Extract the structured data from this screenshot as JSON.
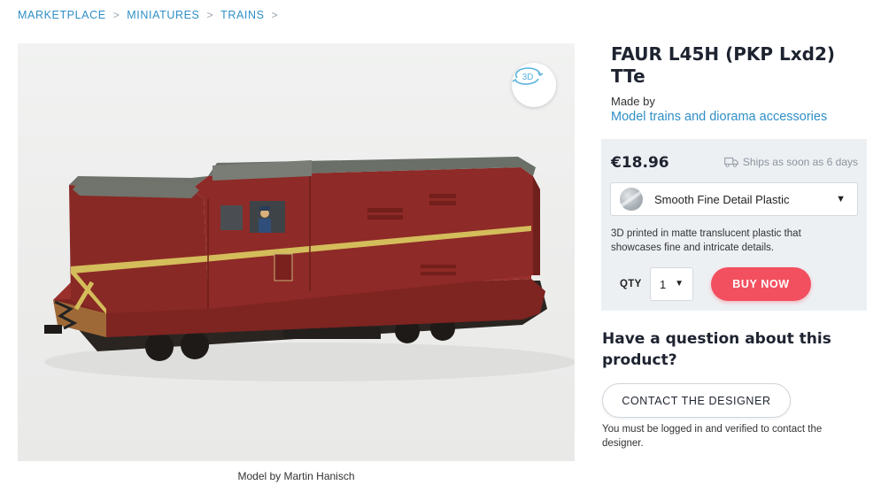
{
  "breadcrumb": {
    "items": [
      "MARKETPLACE",
      "MINIATURES",
      "TRAINS"
    ],
    "separator": ">"
  },
  "product": {
    "title": "FAUR L45H (PKP Lxd2) TTe",
    "image_caption": "Model by Martin Hanisch",
    "badge_label": "3D",
    "made_by_label": "Made by",
    "designer": "Model trains and diorama accessories"
  },
  "purchase": {
    "price": "€18.96",
    "shipping": "Ships as soon as 6 days",
    "material": {
      "selected": "Smooth Fine Detail Plastic",
      "description": "3D printed in matte translucent plastic that showcases fine and intricate details."
    },
    "qty_label": "QTY",
    "qty_value": "1",
    "buy_label": "BUY NOW"
  },
  "contact": {
    "heading": "Have a question about this product?",
    "button_label": "CONTACT THE DESIGNER",
    "note": "You must be logged in and verified to contact the designer."
  },
  "colors": {
    "accent_link": "#2f8fc7",
    "buy_button": "#f3505f",
    "buybox_bg": "#edf0f3",
    "loco_body": "#8e2a27",
    "loco_roof": "#6c7166"
  },
  "icons": {
    "breadcrumb_separator": "chevron-right-icon",
    "badge": "rotate-3d-icon",
    "shipping": "truck-icon",
    "dropdown": "caret-down-icon"
  }
}
